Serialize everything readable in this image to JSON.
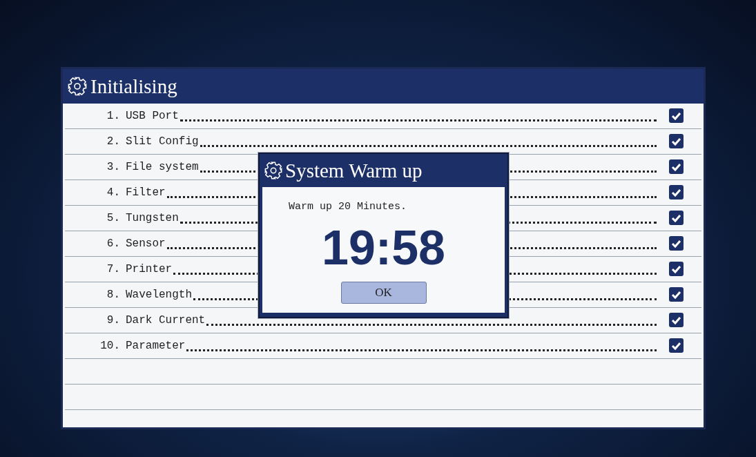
{
  "panel": {
    "title": "Initialising"
  },
  "items": [
    {
      "number": "1.",
      "label": "USB Port",
      "checked": true
    },
    {
      "number": "2.",
      "label": "Slit Config",
      "checked": true
    },
    {
      "number": "3.",
      "label": "File system",
      "checked": true
    },
    {
      "number": "4.",
      "label": "Filter",
      "checked": true
    },
    {
      "number": "5.",
      "label": "Tungsten",
      "checked": true
    },
    {
      "number": "6.",
      "label": "Sensor",
      "checked": true
    },
    {
      "number": "7.",
      "label": "Printer",
      "checked": true
    },
    {
      "number": "8.",
      "label": "Wavelength",
      "checked": true
    },
    {
      "number": "9.",
      "label": "Dark Current",
      "checked": true
    },
    {
      "number": "10.",
      "label": "Parameter",
      "checked": true
    }
  ],
  "dialog": {
    "title": "System Warm up",
    "message": "Warm up 20 Minutes.",
    "countdown": "19:58",
    "button": "OK"
  }
}
